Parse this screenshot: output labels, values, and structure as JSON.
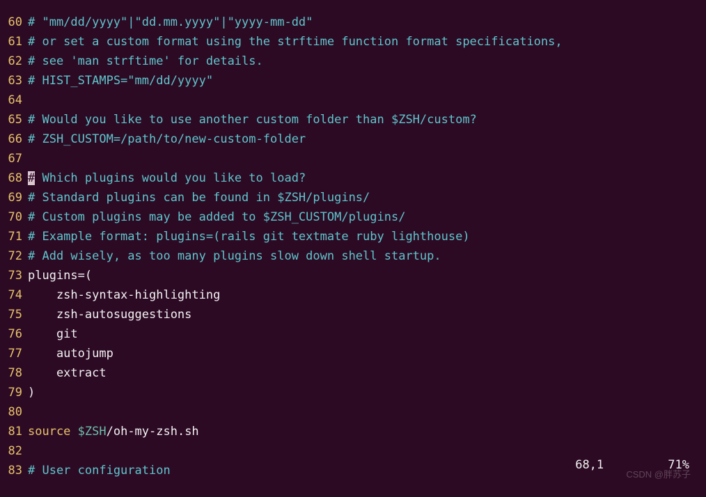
{
  "editor": {
    "lines": [
      {
        "num": "60",
        "segments": [
          {
            "cls": "tok-comment",
            "text": "# \"mm/dd/yyyy\"|\"dd.mm.yyyy\"|\"yyyy-mm-dd\""
          }
        ]
      },
      {
        "num": "61",
        "segments": [
          {
            "cls": "tok-comment",
            "text": "# or set a custom format using the strftime function format specifications,"
          }
        ]
      },
      {
        "num": "62",
        "segments": [
          {
            "cls": "tok-comment",
            "text": "# see 'man strftime' for details."
          }
        ]
      },
      {
        "num": "63",
        "segments": [
          {
            "cls": "tok-comment",
            "text": "# HIST_STAMPS=\"mm/dd/yyyy\""
          }
        ]
      },
      {
        "num": "64",
        "segments": [
          {
            "cls": "tok-plain",
            "text": ""
          }
        ]
      },
      {
        "num": "65",
        "segments": [
          {
            "cls": "tok-comment",
            "text": "# Would you like to use another custom folder than $ZSH/custom?"
          }
        ]
      },
      {
        "num": "66",
        "segments": [
          {
            "cls": "tok-comment",
            "text": "# ZSH_CUSTOM=/path/to/new-custom-folder"
          }
        ]
      },
      {
        "num": "67",
        "segments": [
          {
            "cls": "tok-plain",
            "text": ""
          }
        ]
      },
      {
        "num": "68",
        "segments": [
          {
            "cls": "cursor",
            "text": "#"
          },
          {
            "cls": "tok-comment",
            "text": " Which plugins would you like to load?"
          }
        ]
      },
      {
        "num": "69",
        "segments": [
          {
            "cls": "tok-comment",
            "text": "# Standard plugins can be found in $ZSH/plugins/"
          }
        ]
      },
      {
        "num": "70",
        "segments": [
          {
            "cls": "tok-comment",
            "text": "# Custom plugins may be added to $ZSH_CUSTOM/plugins/"
          }
        ]
      },
      {
        "num": "71",
        "segments": [
          {
            "cls": "tok-comment",
            "text": "# Example format: plugins=(rails git textmate ruby lighthouse)"
          }
        ]
      },
      {
        "num": "72",
        "segments": [
          {
            "cls": "tok-comment",
            "text": "# Add wisely, as too many plugins slow down shell startup."
          }
        ]
      },
      {
        "num": "73",
        "segments": [
          {
            "cls": "tok-plain",
            "text": "plugins=("
          }
        ]
      },
      {
        "num": "74",
        "segments": [
          {
            "cls": "tok-plain",
            "text": "    zsh-syntax-highlighting"
          }
        ]
      },
      {
        "num": "75",
        "segments": [
          {
            "cls": "tok-plain",
            "text": "    zsh-autosuggestions"
          }
        ]
      },
      {
        "num": "76",
        "segments": [
          {
            "cls": "tok-plain",
            "text": "    git"
          }
        ]
      },
      {
        "num": "77",
        "segments": [
          {
            "cls": "tok-plain",
            "text": "    autojump"
          }
        ]
      },
      {
        "num": "78",
        "segments": [
          {
            "cls": "tok-plain",
            "text": "    extract"
          }
        ]
      },
      {
        "num": "79",
        "segments": [
          {
            "cls": "tok-plain",
            "text": ")"
          }
        ]
      },
      {
        "num": "80",
        "segments": [
          {
            "cls": "tok-plain",
            "text": ""
          }
        ]
      },
      {
        "num": "81",
        "segments": [
          {
            "cls": "tok-keyword",
            "text": "source "
          },
          {
            "cls": "tok-var",
            "text": "$ZSH"
          },
          {
            "cls": "tok-plain",
            "text": "/oh-my-zsh.sh"
          }
        ]
      },
      {
        "num": "82",
        "segments": [
          {
            "cls": "tok-plain",
            "text": ""
          }
        ]
      },
      {
        "num": "83",
        "segments": [
          {
            "cls": "tok-comment",
            "text": "# User configuration"
          }
        ]
      }
    ]
  },
  "status": {
    "position": "68,1",
    "percent": "71%"
  },
  "watermark": "CSDN @胖苏子"
}
